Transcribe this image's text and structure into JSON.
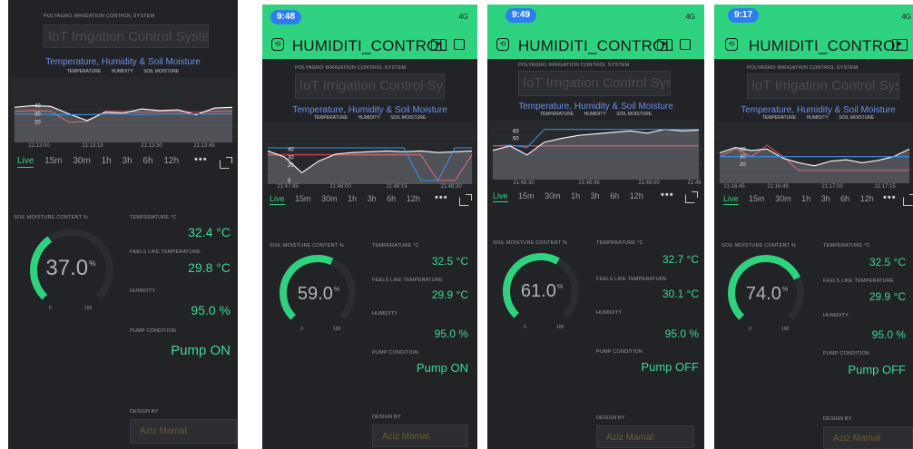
{
  "colors": {
    "accent_green": "#2fd27e",
    "value_green": "#3fd79a",
    "background": "#212326",
    "chart_title_blue": "#6e8fe8",
    "temperature_line": "#e0485a",
    "humidity_line": "#ffffff",
    "soil_line": "#3c8fe6",
    "design_name_color": "#6b5a33"
  },
  "icons": {
    "back": "back-icon",
    "tv": "tv-icon",
    "square": "square-icon",
    "more": "more-dots-icon",
    "share": "share-icon"
  },
  "screens": [
    {
      "status_time": "",
      "signal": "",
      "app_title": "",
      "system_label": "POLYAGRO IRRIGATION CONTROL SYSTEM",
      "title_box": "IoT Irrigation Control System",
      "chart_title": "Temperature, Humidity & Soil Moisture",
      "legend": [
        "TEMPERATURE",
        "HUMIDITY",
        "SOIL MOISTURE"
      ],
      "time_labels": [
        "21:13:00",
        "21:13:15",
        "21:13:30",
        "21:13:45"
      ],
      "ranges": [
        "Live",
        "15m",
        "30m",
        "1h",
        "3h",
        "6h",
        "12h"
      ],
      "more_label": "•••",
      "soil_label": "SOIL MOISTURE CONTENT %",
      "soil_value": "37.0",
      "soil_unit": "%",
      "gauge_min": "0",
      "gauge_max": "100",
      "temp_label": "TEMPERATURE °C",
      "temp_value": "32.4 °C",
      "feels_label": "FEELS LIKE TEMPERATURE",
      "feels_value": "29.8 °C",
      "hum_label": "HUMIDITY",
      "hum_value": "95.0 %",
      "pump_label": "PUMP CONDITION",
      "pump_value": "Pump ON",
      "design_label": "DESIGN BY",
      "design_value": "Aziz Mamat",
      "chart_data": {
        "type": "line",
        "x": [
          "21:13:00",
          "21:13:15",
          "21:13:30",
          "21:13:45"
        ],
        "y_ticks_visible": [
          "40",
          "30",
          "20"
        ],
        "series": [
          {
            "name": "TEMPERATURE",
            "values": [
              33,
              34,
              33,
              20,
              21,
              33,
              33,
              32,
              33,
              33,
              32,
              33,
              33
            ]
          },
          {
            "name": "HUMIDITY",
            "values": [
              38,
              40,
              39,
              30,
              22,
              32,
              31,
              36,
              34,
              35,
              29,
              37,
              38
            ]
          },
          {
            "name": "SOIL MOISTURE",
            "values": [
              30,
              30,
              29,
              29,
              29,
              30,
              30,
              29,
              30,
              30,
              30,
              30,
              30
            ]
          }
        ]
      }
    },
    {
      "status_time": "9:48",
      "signal": "4G",
      "app_title": "HUMIDITI_CONTROL",
      "system_label": "POLYAGRO IRRIGATION CONTROL SYSTEM",
      "title_box": "IoT Irrigation Control System",
      "chart_title": "Temperature, Humidity & Soil Moisture",
      "legend": [
        "TEMPERATURE",
        "HUMIDITY",
        "SOIL MOISTURE"
      ],
      "time_labels": [
        "21:47:45",
        "21:48:00",
        "21:48:15",
        "21:48:30"
      ],
      "ranges": [
        "Live",
        "15m",
        "30m",
        "1h",
        "3h",
        "6h",
        "12h"
      ],
      "more_label": "•••",
      "soil_label": "SOIL MOISTURE CONTENT %",
      "soil_value": "59.0",
      "soil_unit": "%",
      "gauge_min": "0",
      "gauge_max": "100",
      "temp_label": "TEMPERATURE °C",
      "temp_value": "32.5 °C",
      "feels_label": "FEELS LIKE TEMPERATURE",
      "feels_value": "29.9 °C",
      "hum_label": "HUMIDITY",
      "hum_value": "95.0 %",
      "pump_label": "PUMP CONDITION",
      "pump_value": "Pump ON",
      "design_label": "DESIGN BY",
      "design_value": "Aziz Mamat",
      "chart_data": {
        "type": "line",
        "x": [
          "21:47:45",
          "21:48:00",
          "21:48:15",
          "21:48:30"
        ],
        "y_ticks_visible": [
          "40",
          "30",
          "20",
          "0"
        ],
        "series": [
          {
            "name": "TEMPERATURE",
            "values": [
              33,
              33,
              33,
              33,
              33,
              33,
              33,
              33,
              33,
              33,
              0,
              0,
              33
            ]
          },
          {
            "name": "HUMIDITY",
            "values": [
              38,
              30,
              10,
              25,
              34,
              36,
              37,
              38,
              37,
              38,
              36,
              37,
              38
            ]
          },
          {
            "name": "SOIL MOISTURE",
            "values": [
              42,
              42,
              42,
              42,
              42,
              42,
              42,
              42,
              42,
              0,
              0,
              42,
              42
            ]
          }
        ]
      }
    },
    {
      "status_time": "9:49",
      "signal": "4G",
      "app_title": "HUMIDITI_CONTROL",
      "system_label": "POLYAGRO IRRIGATION CONTROL SYSTEM",
      "title_box": "IoT Irrigation Control System",
      "chart_title": "Temperature, Humidity & Soil Moisture",
      "legend": [
        "TEMPERATURE",
        "HUMIDITY",
        "SOIL MOISTURE"
      ],
      "time_labels": [
        "21:48:30",
        "21:48:45",
        "21:49:00",
        "21:49"
      ],
      "ranges": [
        "Live",
        "15m",
        "30m",
        "1h",
        "3h",
        "6h",
        "12h"
      ],
      "more_label": "•••",
      "soil_label": "SOIL MOISTURE CONTENT %",
      "soil_value": "61.0",
      "soil_unit": "%",
      "gauge_min": "0",
      "gauge_max": "100",
      "temp_label": "TEMPERATURE °C",
      "temp_value": "32.7 °C",
      "feels_label": "FEELS LIKE TEMPERATURE",
      "feels_value": "30.1 °C",
      "hum_label": "HUMIDITY",
      "hum_value": "95.0 %",
      "pump_label": "PUMP CONDITION",
      "pump_value": "Pump OFF",
      "design_label": "DESIGN BY",
      "design_value": "Aziz Mamat",
      "chart_data": {
        "type": "line",
        "x": [
          "21:48:30",
          "21:48:45",
          "21:49:00",
          "21:49"
        ],
        "y_ticks_visible": [
          "60",
          "50"
        ],
        "series": [
          {
            "name": "TEMPERATURE",
            "values": [
              40,
              40,
              40,
              40,
              40,
              40,
              40,
              40,
              40,
              40,
              40,
              40,
              40
            ]
          },
          {
            "name": "HUMIDITY",
            "values": [
              34,
              40,
              28,
              45,
              50,
              54,
              56,
              58,
              60,
              57,
              62,
              60,
              61
            ]
          },
          {
            "name": "SOIL MOISTURE",
            "values": [
              40,
              41,
              38,
              62,
              62,
              62,
              62,
              62,
              62,
              62,
              62,
              62,
              62
            ]
          }
        ]
      }
    },
    {
      "status_time": "9:17",
      "signal": "4G",
      "app_title": "HUMIDITI_CONTROL",
      "system_label": "POLYAGRO IRRIGATION CONTROL SYSTEM",
      "title_box": "IoT Irrigation Control System",
      "chart_title": "Temperature, Humidity & Soil Moisture",
      "legend": [
        "TEMPERATURE",
        "HUMIDITY",
        "SOIL MOISTURE"
      ],
      "time_labels": [
        "21:16:45",
        "21:16:49",
        "21:17:00",
        "21:17:15"
      ],
      "ranges": [
        "Live",
        "15m",
        "30m",
        "1h",
        "3h",
        "6h",
        "12h"
      ],
      "more_label": "•••",
      "soil_label": "SOIL MOISTURE CONTENT %",
      "soil_value": "74.0",
      "soil_unit": "%",
      "gauge_min": "0",
      "gauge_max": "100",
      "temp_label": "TEMPERATURE °C",
      "temp_value": "32.5 °C",
      "feels_label": "FEELS LIKE TEMPERATURE",
      "feels_value": "29.9 °C",
      "hum_label": "HUMIDITY",
      "hum_value": "95.0 %",
      "pump_label": "PUMP CONDITION",
      "pump_value": "Pump OFF",
      "design_label": "DESIGN BY",
      "design_value": "Aziz Mamat",
      "chart_data": {
        "type": "line",
        "x": [
          "21:16:45",
          "21:16:49",
          "21:17:00",
          "21:17:15"
        ],
        "y_ticks_visible": [
          "40",
          "30",
          "20"
        ],
        "series": [
          {
            "name": "TEMPERATURE",
            "values": [
              30,
              40,
              30,
              45,
              30,
              12,
              12,
              12,
              12,
              12,
              12,
              12,
              12
            ]
          },
          {
            "name": "HUMIDITY",
            "values": [
              35,
              42,
              38,
              40,
              28,
              22,
              18,
              24,
              26,
              22,
              25,
              30,
              40
            ]
          },
          {
            "name": "SOIL MOISTURE",
            "values": [
              30,
              30,
              30,
              30,
              30,
              30,
              30,
              30,
              30,
              30,
              30,
              30,
              30
            ]
          }
        ]
      }
    }
  ]
}
